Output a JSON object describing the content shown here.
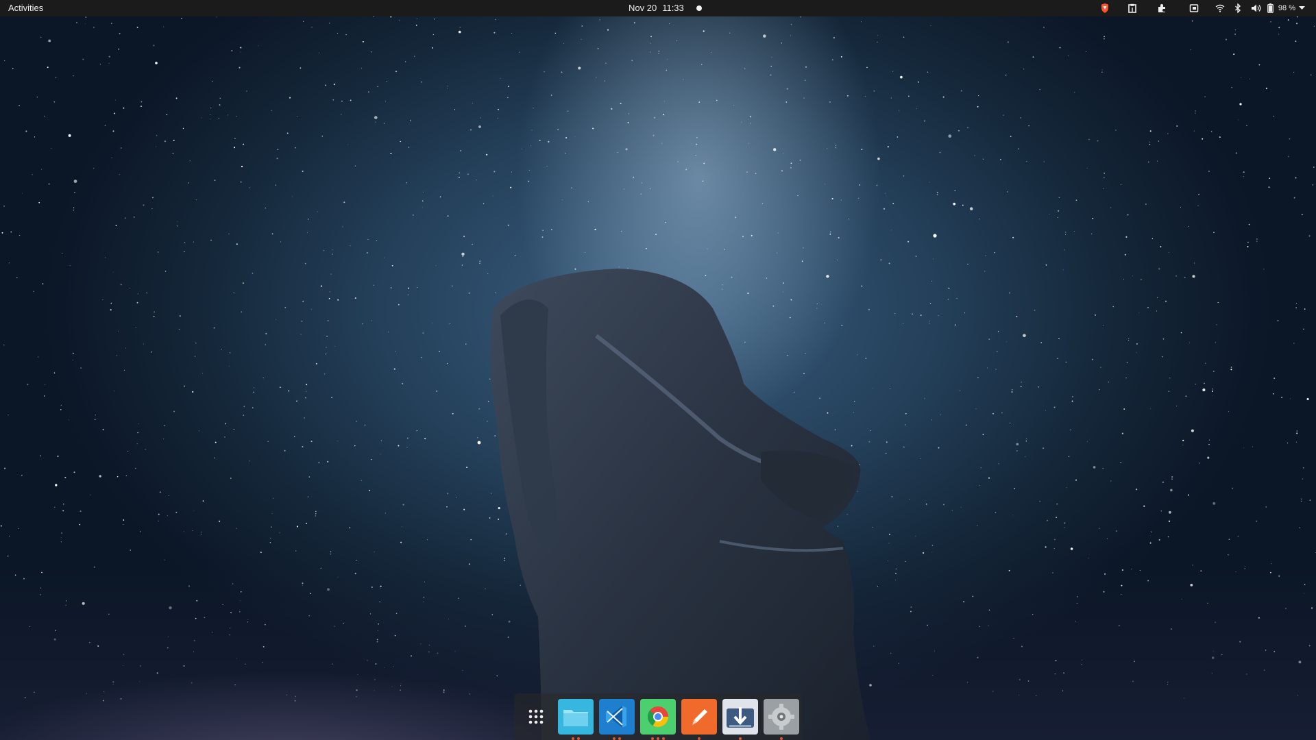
{
  "topbar": {
    "activities_label": "Activities",
    "date": "Nov 20",
    "time": "11:33",
    "tray": {
      "icons": [
        "brave-shield-icon",
        "clipboard-icon",
        "extensions-icon",
        "screen-mirror-icon",
        "wifi-icon",
        "bluetooth-icon",
        "volume-icon",
        "battery-icon",
        "chevron-down-icon"
      ],
      "battery_percent": "98 %"
    }
  },
  "dock": {
    "items": [
      {
        "name": "show-applications",
        "icon": "app-grid-icon",
        "running_dots": 0
      },
      {
        "name": "files",
        "icon": "folder-icon",
        "running_dots": 2
      },
      {
        "name": "vscode",
        "icon": "vscode-icon",
        "running_dots": 2
      },
      {
        "name": "chrome",
        "icon": "chrome-icon",
        "running_dots": 3
      },
      {
        "name": "drawing",
        "icon": "pen-icon",
        "running_dots": 1
      },
      {
        "name": "software-updater",
        "icon": "download-icon",
        "running_dots": 1
      },
      {
        "name": "settings",
        "icon": "settings-icon",
        "running_dots": 1
      }
    ]
  },
  "colors": {
    "topbar_bg": "#1b1b1b",
    "accent_dot": "#e0582e",
    "sky_top": "#24405a",
    "sky_glow": "#a0bed7"
  }
}
